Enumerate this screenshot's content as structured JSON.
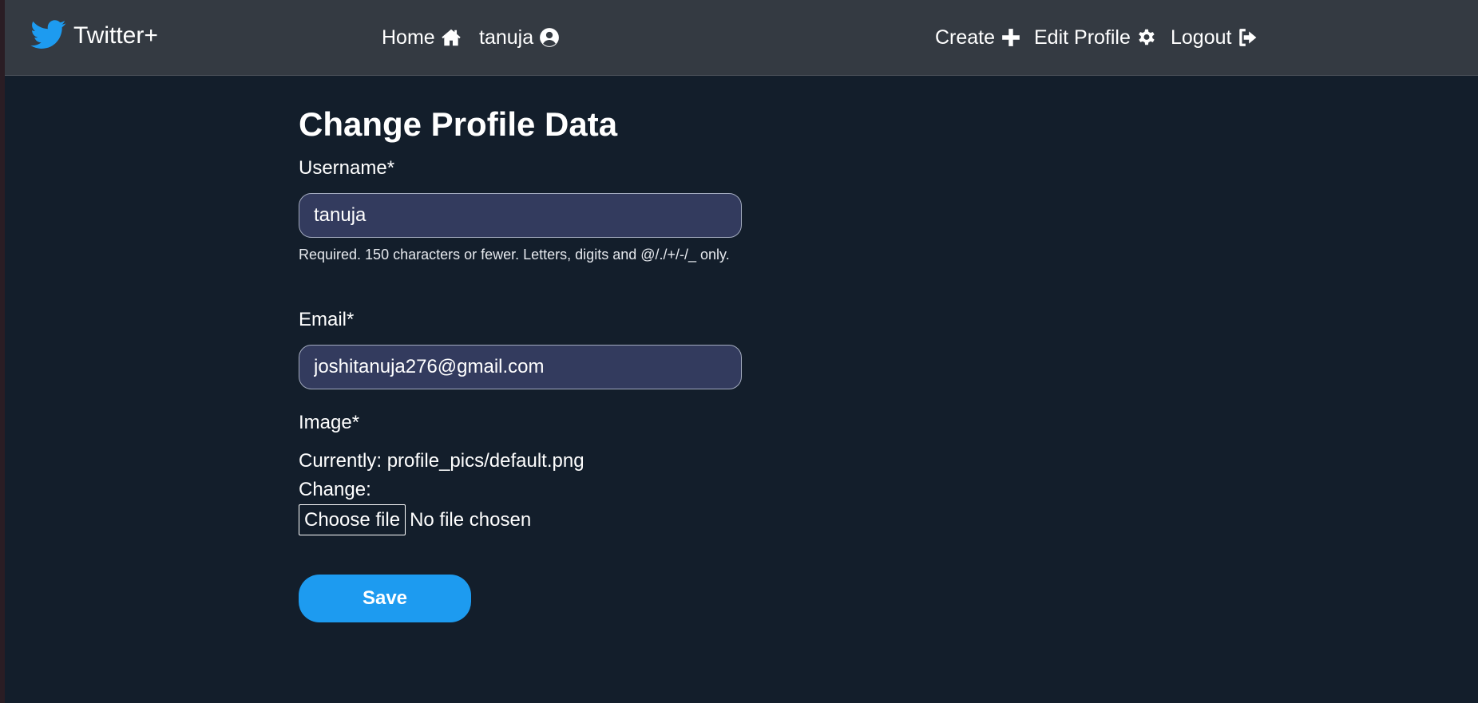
{
  "navbar": {
    "brand": "Twitter+",
    "brand_icon": "twitter-bird-icon",
    "links": {
      "home": {
        "label": "Home",
        "icon": "home-icon"
      },
      "profile": {
        "label": "tanuja",
        "icon": "user-circle-icon"
      },
      "create": {
        "label": "Create",
        "icon": "plus-icon"
      },
      "edit_profile": {
        "label": "Edit Profile",
        "icon": "gear-icon"
      },
      "logout": {
        "label": "Logout",
        "icon": "logout-icon"
      }
    }
  },
  "form": {
    "title": "Change Profile Data",
    "username": {
      "label": "Username*",
      "value": "tanuja",
      "help": "Required. 150 characters or fewer. Letters, digits and @/./+/-/_ only."
    },
    "email": {
      "label": "Email*",
      "value": "joshitanuja276@gmail.com"
    },
    "image": {
      "label": "Image*",
      "currently_label": "Currently:",
      "current_file": "profile_pics/default.png",
      "change_label": "Change:",
      "choose_button": "Choose file",
      "file_status": "No file chosen"
    },
    "save_label": "Save"
  },
  "colors": {
    "background": "#131e2b",
    "navbar": "#343a42",
    "input_bg": "#333b5e",
    "accent": "#1d9bf0",
    "brand_bird": "#1d9bf0"
  }
}
